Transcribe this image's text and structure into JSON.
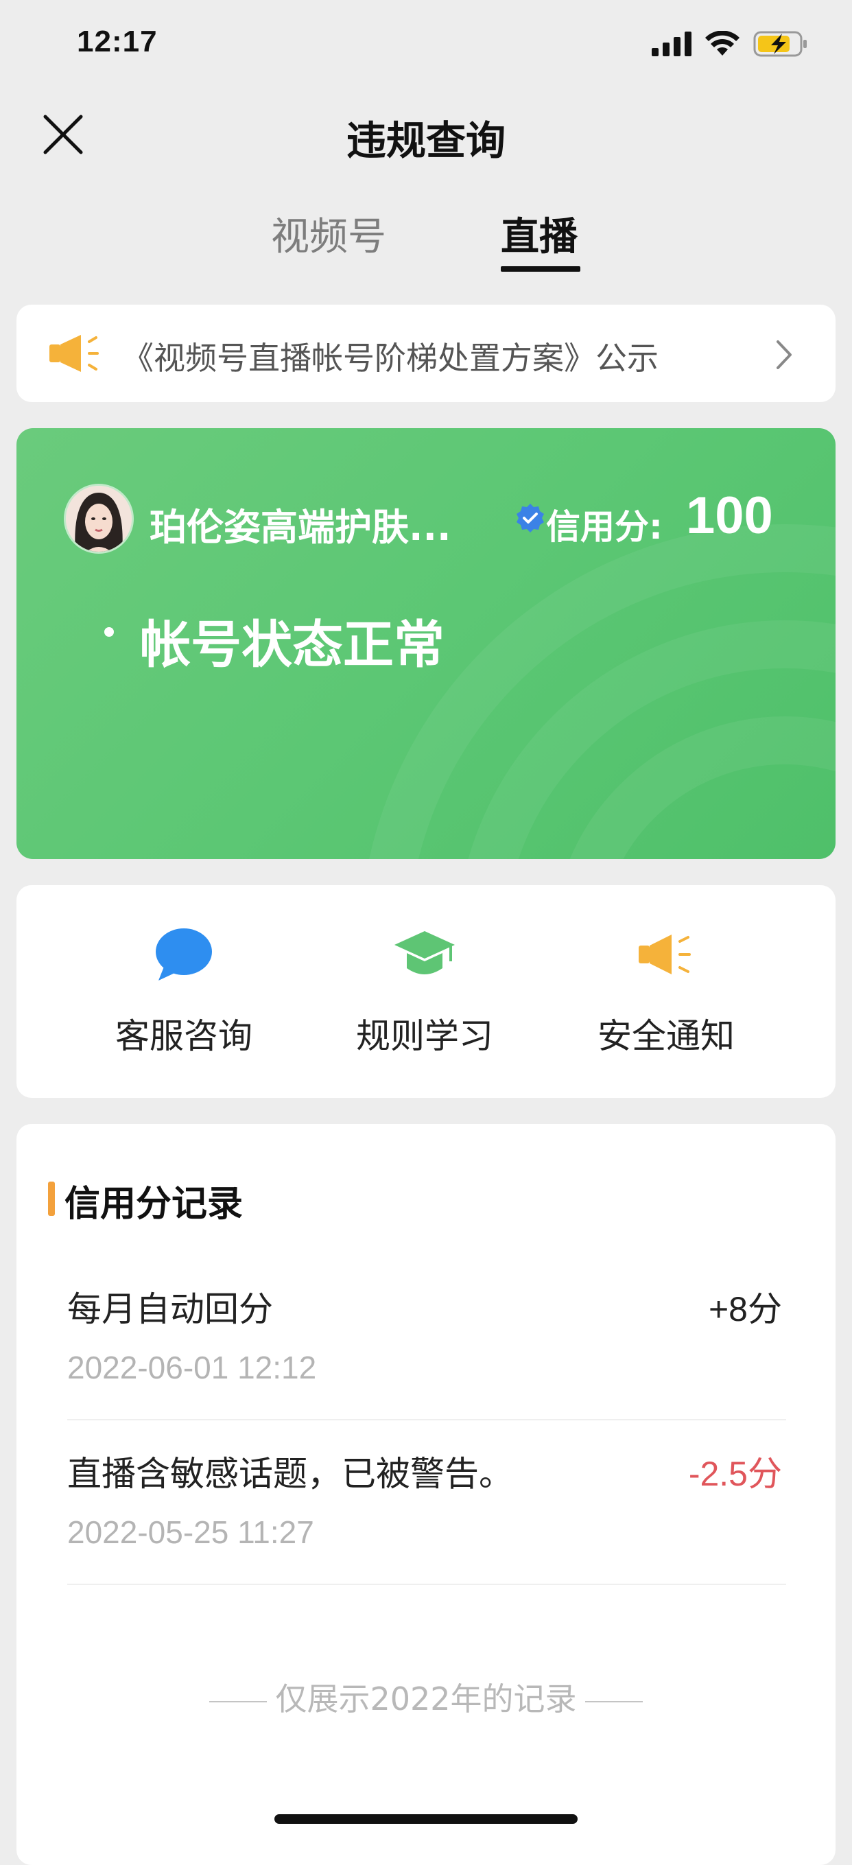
{
  "status_bar": {
    "time": "12:17"
  },
  "nav": {
    "title": "违规查询"
  },
  "tabs": [
    {
      "label": "视频号",
      "active": false
    },
    {
      "label": "直播",
      "active": true
    }
  ],
  "notice": {
    "text": "《视频号直播帐号阶梯处置方案》公示"
  },
  "account_card": {
    "name": "珀伦姿高端护肤...",
    "credit_label": "信用分:",
    "credit_score": "100",
    "status": "帐号状态正常",
    "colors": {
      "card_green": "#5cc774",
      "verify_blue": "#3b82e6"
    }
  },
  "actions": [
    {
      "label": "客服咨询",
      "icon": "chat-bubble-icon",
      "color": "#2e8ef0"
    },
    {
      "label": "规则学习",
      "icon": "graduation-cap-icon",
      "color": "#5ec574"
    },
    {
      "label": "安全通知",
      "icon": "megaphone-icon",
      "color": "#f5b23a"
    }
  ],
  "records": {
    "title": "信用分记录",
    "items": [
      {
        "description": "每月自动回分",
        "time": "2022-06-01 12:12",
        "change_num": "+8",
        "change_unit": "分",
        "color": "#222222"
      },
      {
        "description": "直播含敏感话题，已被警告。",
        "time": "2022-05-25 11:27",
        "change_num": "-2.5",
        "change_unit": "分",
        "color": "#e0565b"
      }
    ],
    "footer": "仅展示2022年的记录"
  }
}
